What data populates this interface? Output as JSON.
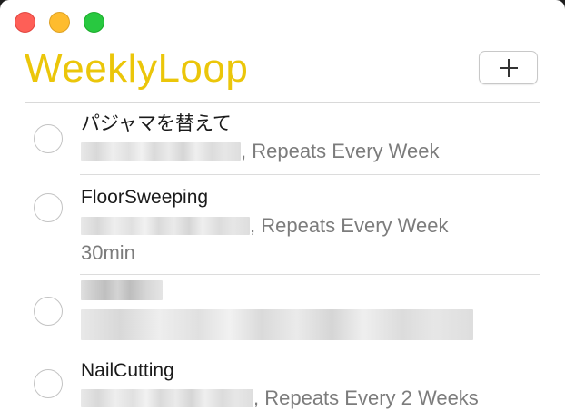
{
  "app": {
    "title": "WeeklyLoop",
    "accent_color": "#ebc60a",
    "add_button_icon": "plus-icon"
  },
  "window_controls": [
    "close",
    "minimize",
    "zoom"
  ],
  "items": [
    {
      "title": "パジャマを替えて",
      "subtitle": ", Repeats Every Week",
      "note": ""
    },
    {
      "title": "FloorSweeping",
      "subtitle": ", Repeats Every Week",
      "note": "30min"
    },
    {
      "title": "",
      "subtitle": "",
      "note": ""
    },
    {
      "title": "NailCutting",
      "subtitle": ", Repeats Every 2 Weeks",
      "note": ""
    }
  ]
}
